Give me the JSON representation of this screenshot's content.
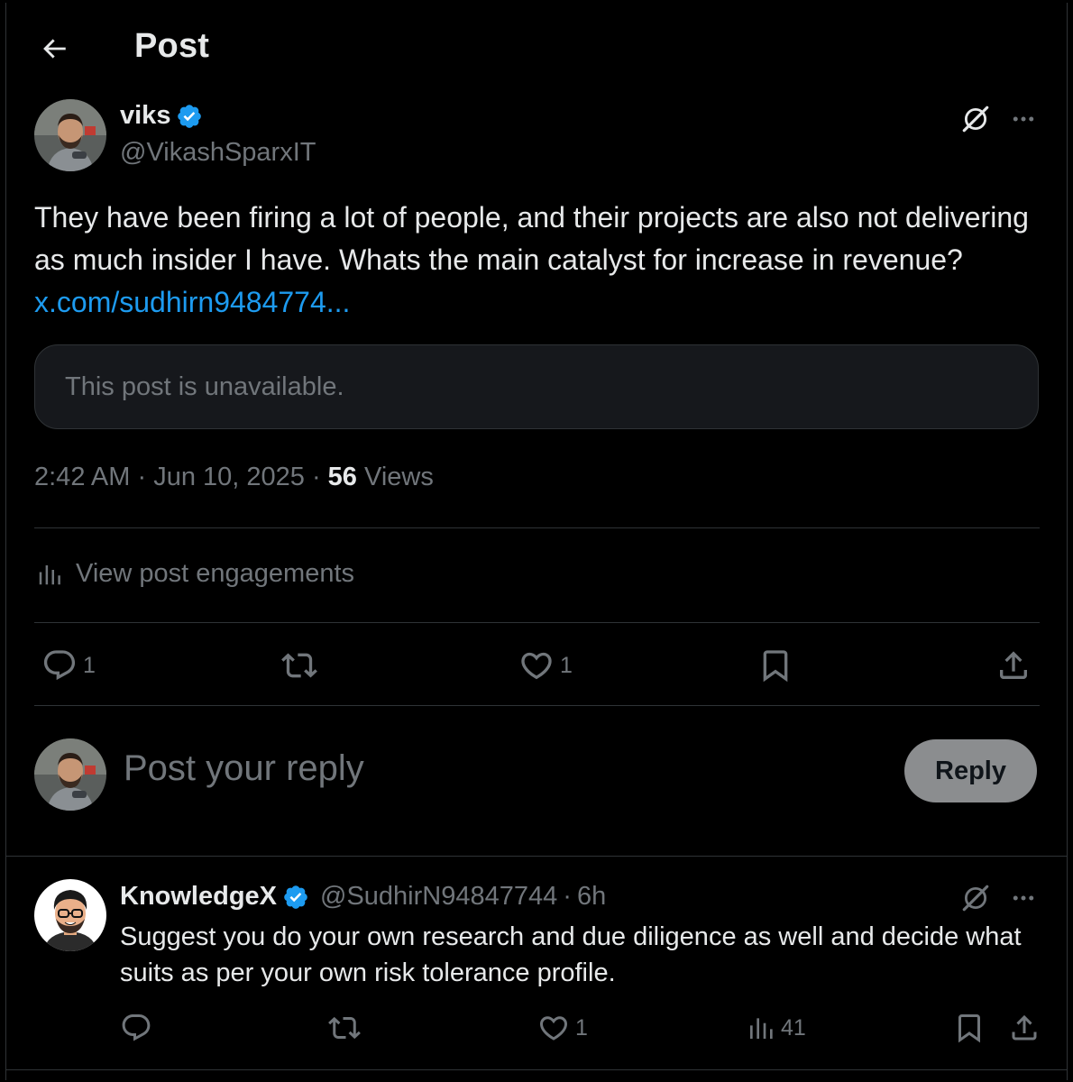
{
  "header": {
    "title": "Post"
  },
  "post": {
    "author_name": "viks",
    "author_handle": "@VikashSparxIT",
    "text": "They have been firing a lot of people, and their projects are also not delivering as much insider I have. Whats the main catalyst for increase in revenue?",
    "link_text": "x.com/sudhirn9484774...",
    "quoted_post": "This post is unavailable.",
    "time": "2:42 AM",
    "date": "Jun 10, 2025",
    "views_count": "56",
    "views_label": "Views",
    "separator": " · ",
    "engagements_label": "View post engagements",
    "actions": {
      "reply_count": "1",
      "like_count": "1"
    }
  },
  "composer": {
    "placeholder": "Post your reply",
    "button_label": "Reply"
  },
  "reply": {
    "author_name": "KnowledgeX",
    "author_handle": "@SudhirN94847744",
    "time": "6h",
    "separator": " · ",
    "text": "Suggest you do your own research and due diligence as well and decide what suits as per your own risk tolerance profile.",
    "actions": {
      "like_count": "1",
      "views_count": "41"
    }
  },
  "colors": {
    "background": "#000000",
    "text_primary": "#e7e9ea",
    "text_secondary": "#71767b",
    "link": "#1d9bf0",
    "verified_badge": "#1d9bf0",
    "divider": "#2f3336",
    "reply_button_bg": "#8b8d8f"
  },
  "icons": [
    "back-arrow-icon",
    "verified-badge-icon",
    "grok-icon",
    "more-icon",
    "engagements-chart-icon",
    "reply-icon",
    "repost-icon",
    "like-icon",
    "bookmark-icon",
    "share-icon",
    "views-icon"
  ]
}
